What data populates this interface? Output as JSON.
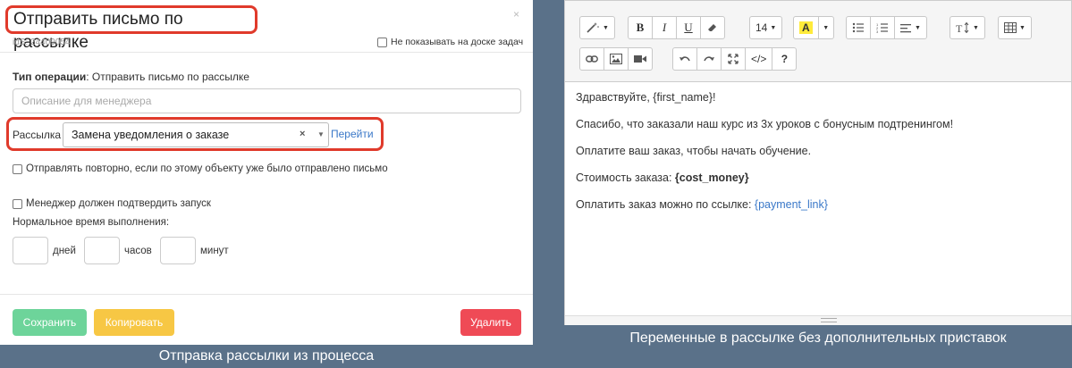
{
  "dialog": {
    "title": "Отправить письмо по рассылке",
    "close_glyph": "×",
    "ids": "idS: 24409054",
    "hide_from_board": "Не показывать на доске задач",
    "operation_label": "Тип операции",
    "operation_value": ": Отправить письмо по рассылке",
    "description_placeholder": "Описание для менеджера",
    "mailing_label": "Рассылка",
    "mailing_value": "Замена уведомления о заказе",
    "clear_glyph": "×",
    "dropdown_glyph": "▼",
    "go_link": "Перейти",
    "resend_checkbox": "Отправлять повторно, если по этому объекту уже было отправлено письмо",
    "manager_confirm_checkbox": "Менеджер должен подтвердить запуск",
    "normal_time_label": "Нормальное время выполнения:",
    "days_label": "дней",
    "hours_label": "часов",
    "minutes_label": "минут",
    "save_button": "Сохранить",
    "copy_button": "Копировать",
    "delete_button": "Удалить"
  },
  "caption_left": "Отправка рассылки из процесса",
  "editor": {
    "toolbar": {
      "font_size": "14",
      "color_letter": "A",
      "help": "?",
      "code": "</>"
    },
    "content": {
      "line1": "Здравствуйте, {first_name}!",
      "line2": "Спасибо, что заказали наш курс из 3х уроков с бонусным подтренингом!",
      "line3": "Оплатите ваш заказ, чтобы начать обучение.",
      "line4_prefix": "Стоимость заказа: ",
      "line4_var": "{cost_money}",
      "line5_prefix": "Оплатить заказ можно по ссылке: ",
      "line5_var": "{payment_link}"
    }
  },
  "caption_right": "Переменные в рассылке без дополнительных приставок",
  "colors": {
    "background": "#5a7189",
    "highlight_border": "#e03a2b",
    "save": "#6dd49a",
    "copy": "#f7c744",
    "delete": "#ef4a56",
    "link": "#3a78c8"
  }
}
